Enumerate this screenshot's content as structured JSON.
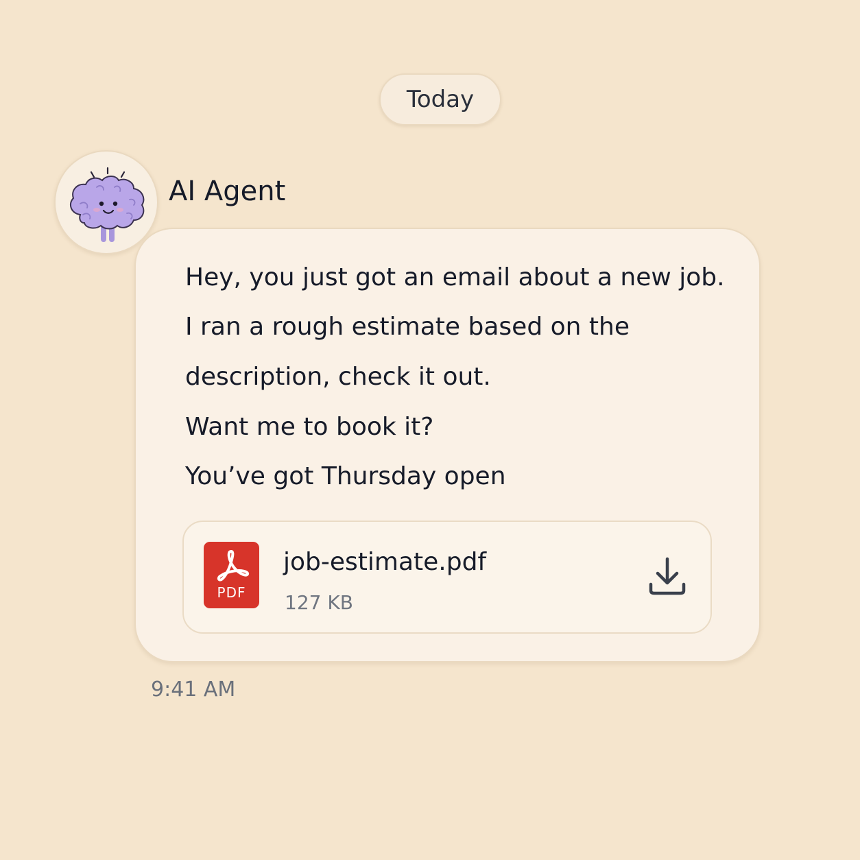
{
  "divider": {
    "date_label": "Today"
  },
  "message": {
    "sender_name": "AI Agent",
    "avatar_icon": "brain-mascot-icon",
    "lines": [
      "Hey, you just got an email about a new job.",
      "I ran a rough estimate based on the",
      "description, check it out.",
      "Want me to book it?",
      "You’ve got Thursday open"
    ],
    "attachment": {
      "file_name": "job-estimate.pdf",
      "file_size": "127 KB",
      "type_label": "PDF",
      "type_icon": "pdf-file-icon",
      "action_icon": "download-icon"
    },
    "timestamp": "9:41 AM"
  },
  "colors": {
    "background": "#f5e5cd",
    "bubble": "#faf1e6",
    "pdf_red": "#d7342a",
    "avatar_purple": "#b9a6e8"
  }
}
